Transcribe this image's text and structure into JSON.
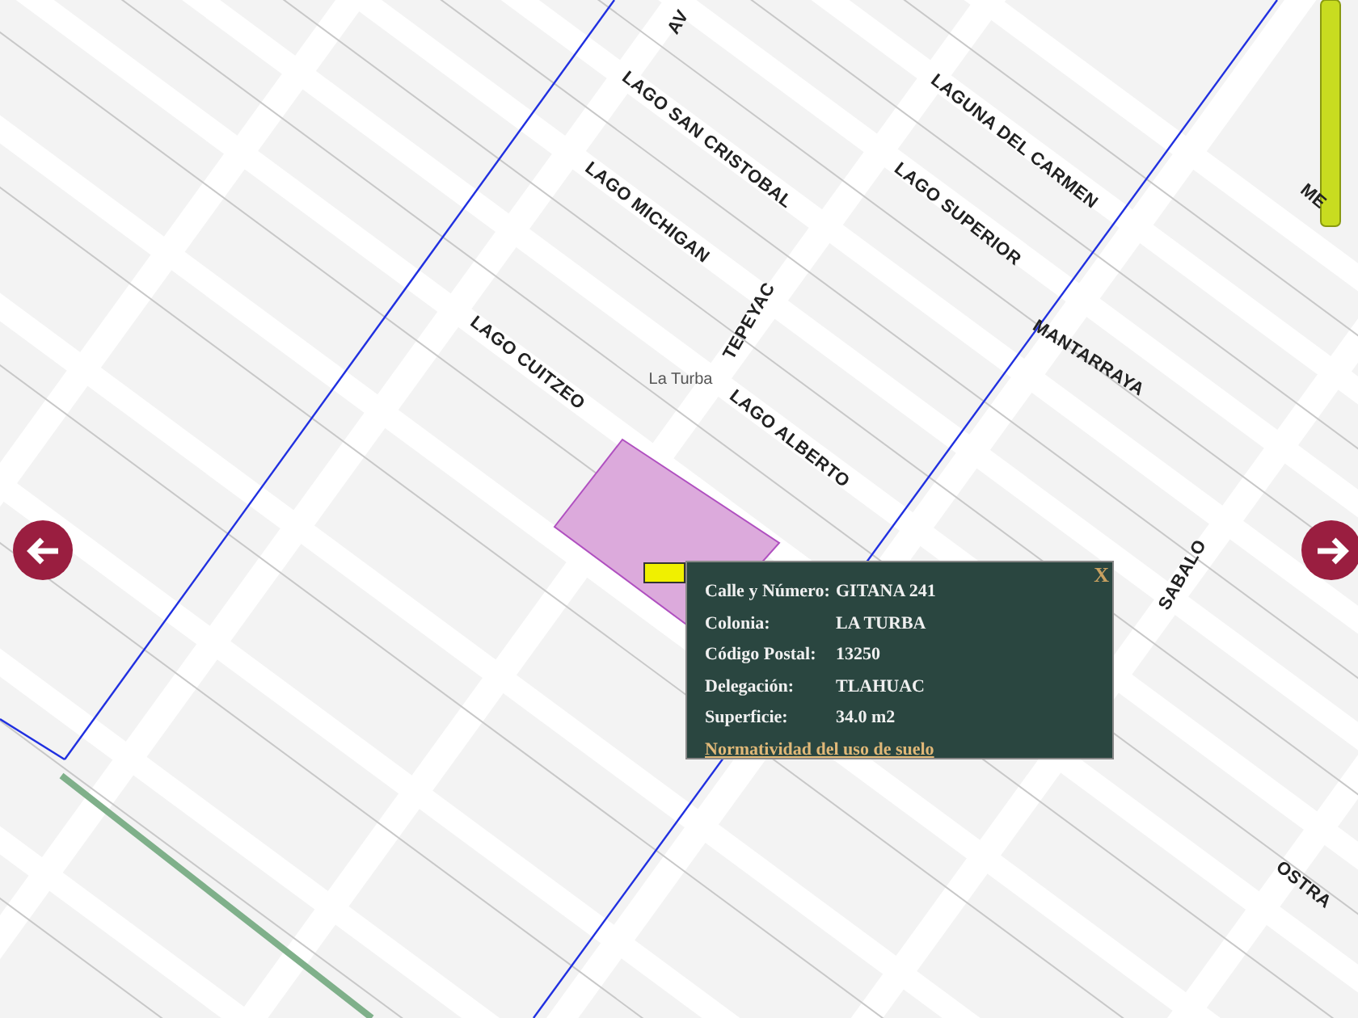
{
  "streets": [
    {
      "name": "AV"
    },
    {
      "name": "LAGO SAN CRISTOBAL"
    },
    {
      "name": "LAGUNA DEL CARMEN"
    },
    {
      "name": "LAGO MICHIGAN"
    },
    {
      "name": "LAGO SUPERIOR"
    },
    {
      "name": "TEPEYAC"
    },
    {
      "name": "MANTARRAYA"
    },
    {
      "name": "LAGO CUITZEO"
    },
    {
      "name": "La Turba",
      "kind": "colonia"
    },
    {
      "name": "LAGO ALBERTO"
    },
    {
      "name": "SABALO"
    },
    {
      "name": "OSTRA"
    },
    {
      "name": "ME"
    }
  ],
  "popup": {
    "close": "X",
    "fields": [
      {
        "label": "Calle y Número:",
        "value": "GITANA 241"
      },
      {
        "label": "Colonia:",
        "value": "LA TURBA"
      },
      {
        "label": "Código Postal:",
        "value": "13250"
      },
      {
        "label": "Delegación:",
        "value": "TLAHUAC"
      },
      {
        "label": "Superficie:",
        "value": "34.0 m2"
      }
    ],
    "link": "Normatividad del uso de suelo"
  }
}
